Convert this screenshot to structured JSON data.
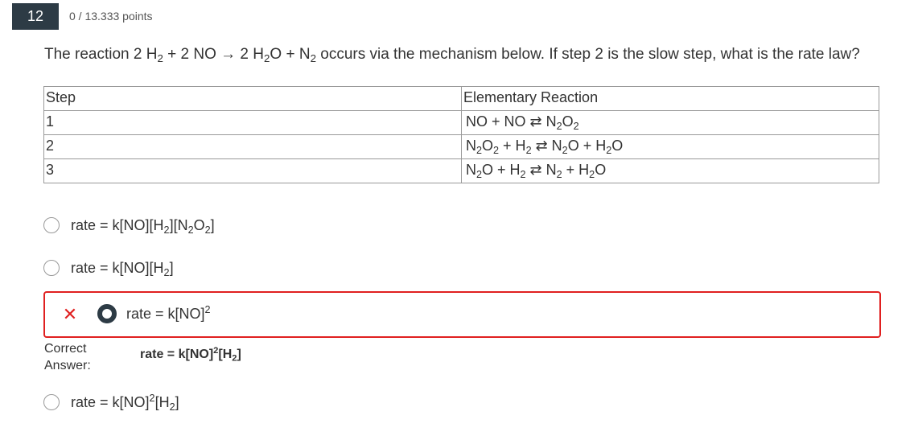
{
  "question": {
    "number": "12",
    "points": "0 / 13.333 points",
    "prompt": {
      "t1": "The reaction 2 H",
      "s1": "2",
      "t2": " + 2 NO → 2 H",
      "s2": "2",
      "t3": "O + N",
      "s3": "2",
      "t4": " occurs via the mechanism below. If step 2 is the slow step, what is the rate law?"
    }
  },
  "mechanism_table": {
    "headers": {
      "step": "Step",
      "reaction": "Elementary Reaction"
    },
    "rows": [
      {
        "step": "1",
        "parts": [
          "NO + NO ⇄ N",
          "2",
          "O",
          "2",
          ""
        ]
      },
      {
        "step": "2",
        "parts": [
          "N",
          "2",
          "O",
          "2",
          " + H",
          "2",
          " ⇄ N",
          "2",
          "O + H",
          "2",
          "O"
        ]
      },
      {
        "step": "3",
        "parts": [
          "N",
          "2",
          "O + H",
          "2",
          " ⇄ N",
          "2",
          " + H",
          "2",
          "O"
        ]
      }
    ]
  },
  "options": [
    {
      "parts": [
        "rate = k[NO][H",
        "2",
        "][N",
        "2",
        "O",
        "2",
        "]"
      ]
    },
    {
      "parts": [
        "rate = k[NO][H",
        "2",
        "]"
      ]
    },
    {
      "parts": [
        "rate = k[NO]",
        "2",
        ""
      ],
      "selected": true
    },
    {
      "parts": [
        "rate = k[NO]",
        "2",
        "[H",
        "2",
        "]"
      ]
    }
  ],
  "feedback": {
    "wrong_mark": "✕",
    "correct_label_line1": "Correct",
    "correct_label_line2": "Answer:",
    "correct_answer_parts": [
      "rate = k[NO]",
      "2",
      "[H",
      "2",
      "]"
    ]
  },
  "colors": {
    "error": "#e02020",
    "header_bg": "#2d3b45"
  }
}
